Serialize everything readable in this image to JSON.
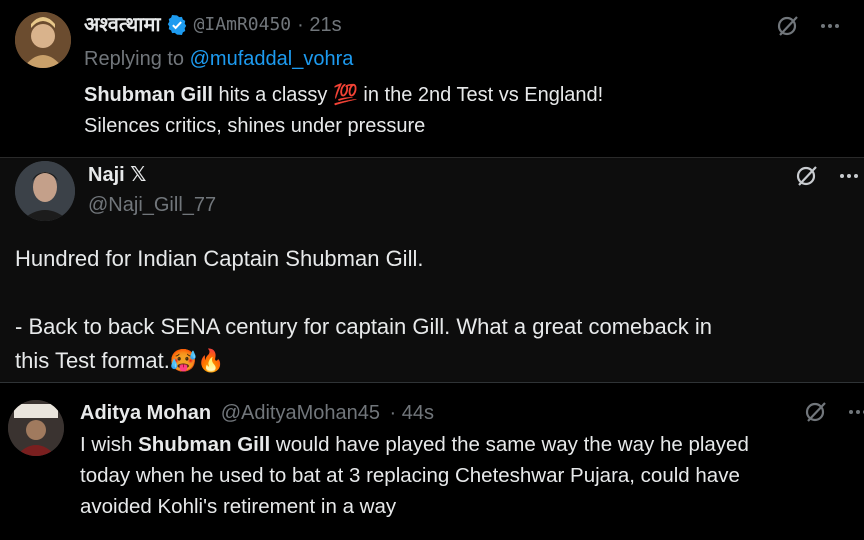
{
  "tweets": [
    {
      "display_name": "अश्वत्थामा",
      "handle": "@IAmR0450",
      "time": "· 21s",
      "replying_prefix": "Replying to",
      "replying_to": "@mufaddal_vohra",
      "line1_bold": "Shubman Gill",
      "line1_mid": " hits a classy ",
      "line1_emoji": "💯",
      "line1_end": " in the 2nd Test vs England!",
      "line2": "Silences critics, shines under pressure"
    },
    {
      "display_name": "Naji",
      "name_badge": "𝕏",
      "handle": "@Naji_Gill_77",
      "para1": "Hundred for Indian Captain Shubman Gill.",
      "para2_line1": "- Back to back SENA century for captain Gill. What a great comeback in",
      "para2_line2": "this Test format.",
      "emojis": "🥵🔥"
    },
    {
      "display_name": "Aditya Mohan",
      "handle": "@AdityaMohan45",
      "time": "· 44s",
      "line1_pre": "I wish ",
      "line1_bold": "Shubman Gill",
      "line1_end": " would have played the same way the way he played",
      "line2": "today when he used to bat at 3 replacing Cheteshwar Pujara, could have",
      "line3": "avoided Kohli's retirement in a way"
    }
  ],
  "colors": {
    "background": "#000000",
    "text": "#e7e9ea",
    "muted": "#71767b",
    "link": "#1d9bf0",
    "verified": "#1d9bf0"
  },
  "icons": [
    "grok-icon",
    "more-icon",
    "verified-badge-icon"
  ]
}
